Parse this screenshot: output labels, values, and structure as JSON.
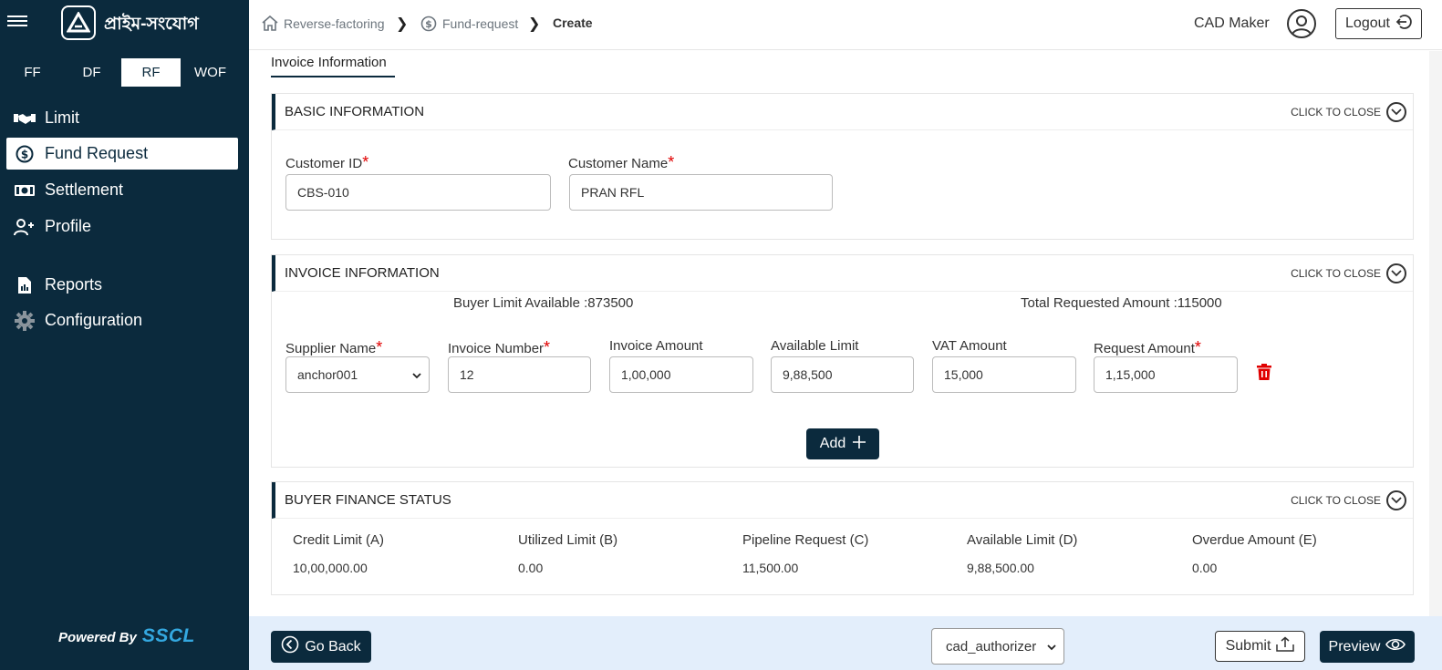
{
  "brand": {
    "logo_text": "প্রাইম-সংযোগ",
    "powered_by": "Powered By",
    "powered_brand": "SSCL"
  },
  "product_tabs": [
    {
      "label": "FF",
      "active": false
    },
    {
      "label": "DF",
      "active": false
    },
    {
      "label": "RF",
      "active": true
    },
    {
      "label": "WOF",
      "active": false
    }
  ],
  "nav": [
    {
      "label": "Limit",
      "icon": "handshake-icon",
      "active": false
    },
    {
      "label": "Fund Request",
      "icon": "dollar-circle-icon",
      "active": true
    },
    {
      "label": "Settlement",
      "icon": "banknote-icon",
      "active": false
    },
    {
      "label": "Profile",
      "icon": "user-plus-icon",
      "active": false
    },
    {
      "label": "Reports",
      "icon": "report-file-icon",
      "active": false
    },
    {
      "label": "Configuration",
      "icon": "gear-icon",
      "active": false
    }
  ],
  "header": {
    "breadcrumbs": [
      "Reverse-factoring",
      "Fund-request",
      "Create"
    ],
    "user_name": "CAD Maker",
    "logout_label": "Logout"
  },
  "page_tab": "Invoice Information",
  "collapse_label": "CLICK TO CLOSE",
  "basic_info": {
    "title": "BASIC INFORMATION",
    "customer_id_label": "Customer ID",
    "customer_id_value": "CBS-010",
    "customer_name_label": "Customer Name",
    "customer_name_value": "PRAN RFL"
  },
  "invoice_info": {
    "title": "INVOICE INFORMATION",
    "buyer_limit_available": "Buyer Limit Available :873500",
    "total_requested_amount": "Total Requested Amount :115000",
    "fields": {
      "supplier_name_label": "Supplier Name",
      "supplier_name_value": "anchor001",
      "invoice_number_label": "Invoice Number",
      "invoice_number_value": "12",
      "invoice_amount_label": "Invoice Amount",
      "invoice_amount_value": "1,00,000",
      "available_limit_label": "Available Limit",
      "available_limit_value": "9,88,500",
      "vat_amount_label": "VAT Amount",
      "vat_amount_value": "15,000",
      "request_amount_label": "Request Amount",
      "request_amount_value": "1,15,000"
    },
    "add_label": "Add"
  },
  "buyer_finance": {
    "title": "BUYER FINANCE STATUS",
    "columns": [
      {
        "label": "Credit Limit (A)",
        "value": "10,00,000.00"
      },
      {
        "label": "Utilized Limit (B)",
        "value": "0.00"
      },
      {
        "label": "Pipeline Request (C)",
        "value": "11,500.00"
      },
      {
        "label": "Available Limit (D)",
        "value": "9,88,500.00"
      },
      {
        "label": "Overdue Amount (E)",
        "value": "0.00"
      }
    ]
  },
  "footer": {
    "go_back_label": "Go Back",
    "role_select_value": "cad_authorizer",
    "submit_label": "Submit",
    "preview_label": "Preview"
  },
  "colors": {
    "primary": "#0b2a3d",
    "required": "#e00000",
    "footer_bg": "#e3eefb",
    "link_blue": "#34a8e0"
  }
}
